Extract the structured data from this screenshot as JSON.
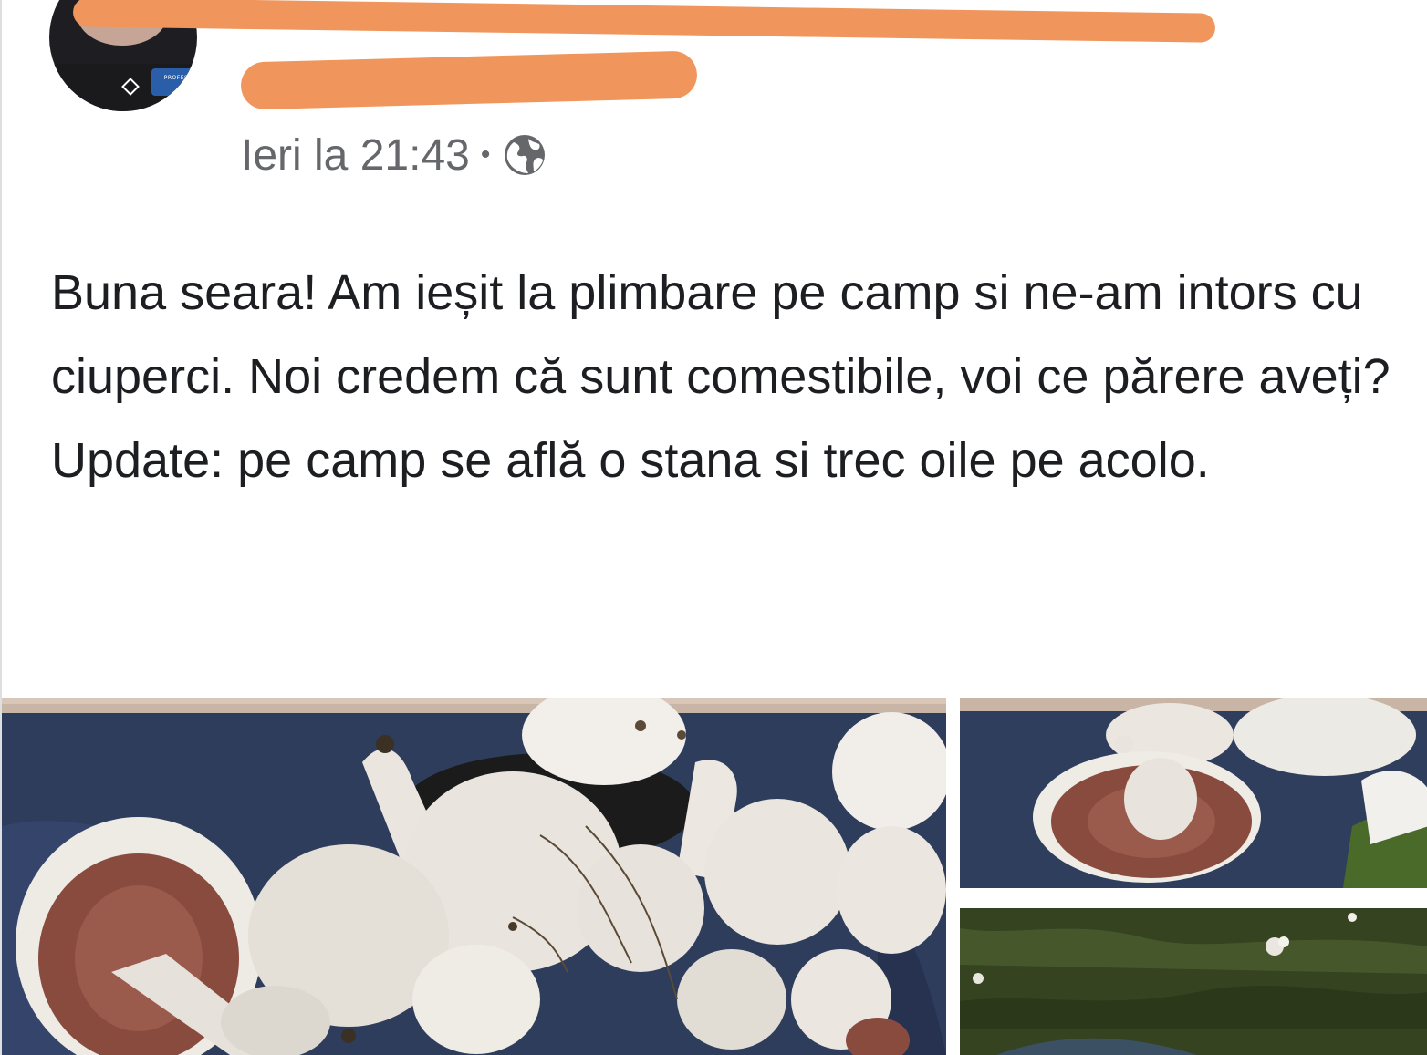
{
  "post": {
    "author_name": "",
    "timestamp": "Ieri la 21:43",
    "separator": "•",
    "privacy_icon": "globe-icon",
    "avatar_badge": "PROFESOR ONLINE",
    "text_lines": [
      "Buna seara! Am ieșit la plimbare pe camp si ne-am intors cu ciuperci. Noi credem că sunt comestibile, voi ce părere aveți?",
      "Update: pe camp se află o stana si trec oile pe acolo."
    ],
    "photos": [
      {
        "description_icon": "mushrooms-photo"
      },
      {
        "description_icon": "mushroom-gills-photo"
      },
      {
        "description_icon": "grass-photo"
      }
    ]
  },
  "colors": {
    "redaction": "#f0955b",
    "meta_text": "#65676b",
    "body_text": "#1c1e21",
    "bag": "#31405f",
    "mushroom": "#eae6df",
    "gills": "#8a4b3f"
  }
}
